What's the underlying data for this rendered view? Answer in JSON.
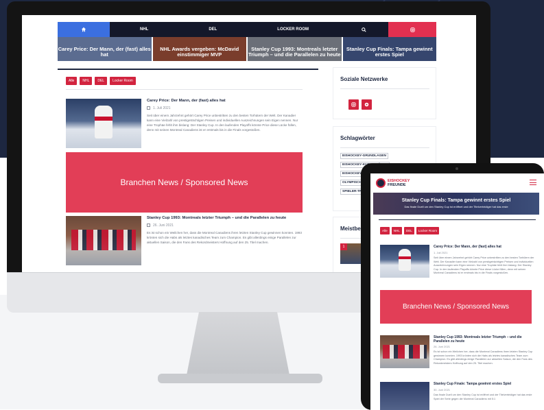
{
  "nav": {
    "home_icon": "home-icon",
    "items": [
      "NHL",
      "DEL",
      "LOCKER ROOM"
    ],
    "search_icon": "search-icon",
    "instagram_icon": "instagram-icon"
  },
  "slider": [
    "Carey Price: Der Mann, der (fast) alles hat",
    "NHL Awards vergeben: McDavid einstimmiger MVP",
    "Stanley Cup 1993: Montreals letzter Triumph – und die Parallelen zu heute",
    "Stanley Cup Finals: Tampa gewinnt erstes Spiel"
  ],
  "filters": [
    "Alle",
    "NHL",
    "DEL",
    "Locker Room"
  ],
  "articles": [
    {
      "title": "Carey Price: Der Mann, der (fast) alles hat",
      "date": "1. Juli 2021",
      "text": "Seit über einem Jahrzehnt gehört Carey Price unbestritten zu den besten Torhütern der Welt. Der Kanadier kann eine Vielzahl von prestigeträchtigen Preisen und individuellen Auszeichnungen sein Eigen nennen. Nur eine Trophäe fehlt ihm bislang: Der Stanley Cup. In den laufenden Playoffs könnte Price diese Lücke füllen, denn mit seinen Montreal Canadiens ist er erstmals bis in die Finals vorgestoßen."
    },
    {
      "title": "Stanley Cup 1993: Montreals letzter Triumph – und die Parallelen zu heute",
      "date": "26. Juni 2021",
      "text": "Es ist schon ein Weilchen her, dass die Montreal Canadiens ihren letzten Stanley Cup gewinnen konnten. 1993 krönten sich die Habs als letztes kanadisches Team zum Champion. Es gibt allerdings einige Parallelen zur aktuellen Saison, die den Fans des Rekordmeisters Hoffnung auf den 25. Titel machen."
    },
    {
      "title": "Stanley Cup Finale: Tampa gewinnt erstes Spiel",
      "date": "30. Juni 2021",
      "text": "Das finale Duell um den Stanley Cup ist eröffnet und der Titelverteidiger hat das erste Spiel der Serie gegen die Montreal Canadiens mit 5:1"
    }
  ],
  "banner": "Branchen News / Sponsored News",
  "sidebar": {
    "social_title": "Soziale Netzwerke",
    "social_icons": [
      "instagram-icon",
      "pinterest-icon"
    ],
    "tags_title": "Schlagwörter",
    "tags": [
      "EISHOCKEY-GRUNDLAGEN",
      "EISHOCKEY-KURIOSITÄTEN",
      "EISHOCKEY-LÄNDER",
      "OLYMPISCHE SPIELE",
      "SPIELER-TRANSFERS"
    ],
    "popular_title": "Meistbesucht",
    "popular_rank": "1"
  },
  "tablet": {
    "logo_line1": "EISHOCKEY",
    "logo_line2": "FREUNDE",
    "hero_title": "Stanley Cup Finals: Tampa gewinnt erstes Spiel",
    "hero_sub": "Das finale Duell um den Stanley Cup ist eröffnet und der Titelverteidiger hat das erste",
    "article3_title": "Stanley Cup Finale: Tampa gewinnt erstes Spiel"
  },
  "colors": {
    "accent": "#d2243f",
    "banner": "#e23e57",
    "navy": "#1d2740",
    "nav_home": "#3b6fe0"
  }
}
